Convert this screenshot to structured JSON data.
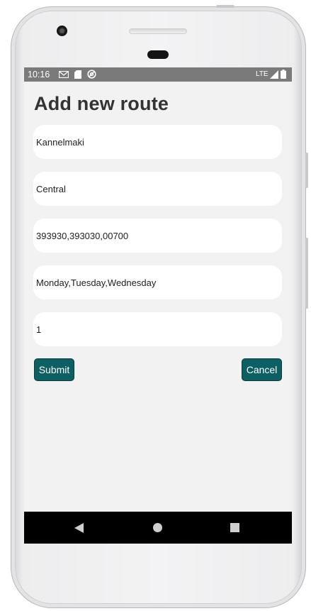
{
  "status_bar": {
    "time": "10:16",
    "network": "LTE",
    "icons": [
      "gmail-icon",
      "sd-card-icon",
      "sync-icon",
      "signal-icon",
      "battery-icon"
    ]
  },
  "page": {
    "title": "Add new route"
  },
  "form": {
    "fields": [
      {
        "name": "start-location",
        "value": "Kannelmaki"
      },
      {
        "name": "destination",
        "value": "Central"
      },
      {
        "name": "stop-codes",
        "value": "393930,393030,00700"
      },
      {
        "name": "days",
        "value": "Monday,Tuesday,Wednesday"
      },
      {
        "name": "count",
        "value": "1"
      }
    ],
    "submit_label": "Submit",
    "cancel_label": "Cancel"
  },
  "colors": {
    "accent": "#0c5f63",
    "screen_background": "#f2f2f2",
    "status_bar": "#7a7a7a",
    "nav_bar": "#000000"
  },
  "nav_bar": {
    "icons": [
      "back-icon",
      "home-icon",
      "recents-icon"
    ]
  }
}
